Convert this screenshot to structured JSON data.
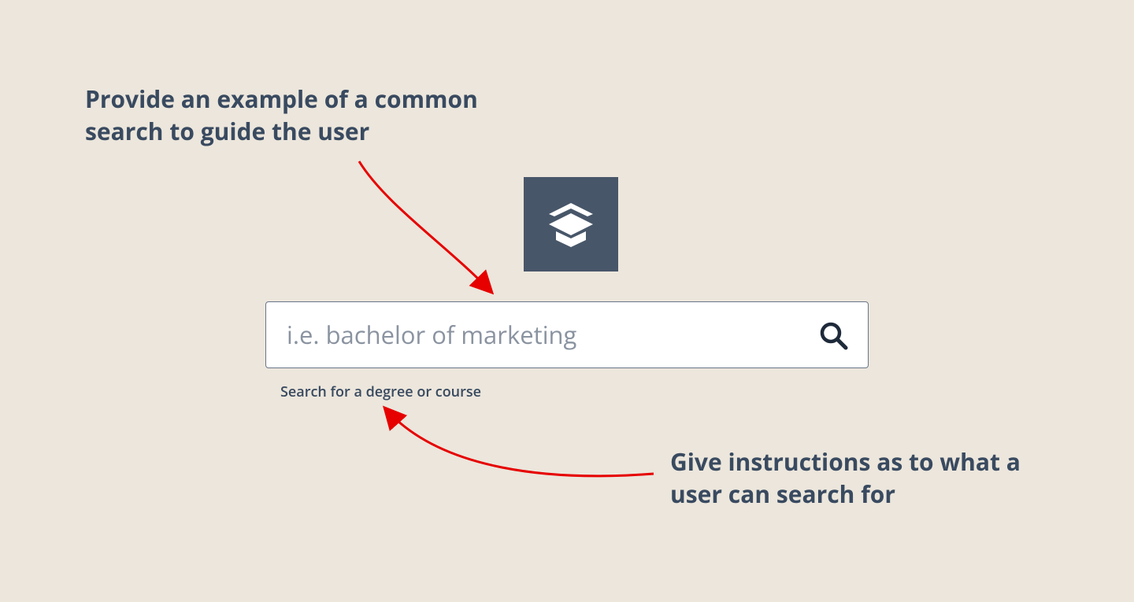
{
  "annotations": {
    "top": "Provide an example of a common search to guide the user",
    "bottom": "Give instructions as to what a user can search for"
  },
  "search": {
    "placeholder": "i.e. bachelor of marketing",
    "helper": "Search for a degree or course"
  },
  "colors": {
    "background": "#ece6dc",
    "ink": "#394a60",
    "tile": "#485669",
    "arrow": "#e60000"
  }
}
